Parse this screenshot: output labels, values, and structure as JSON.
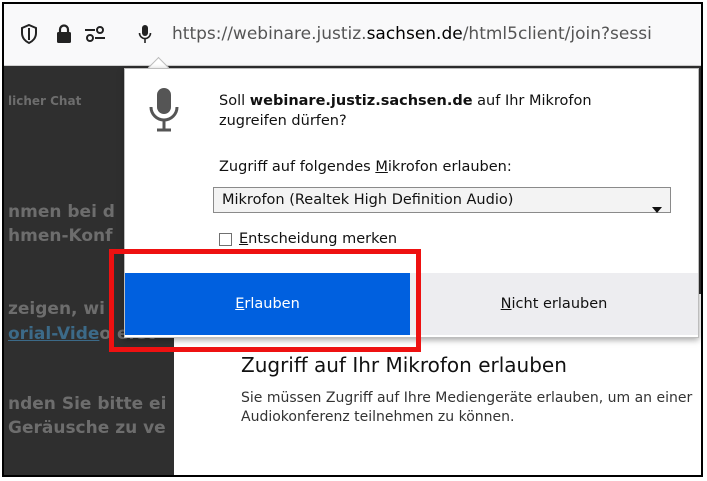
{
  "urlbar": {
    "url_prefix": "https://webinare.justiz.",
    "url_host": "sachsen.de",
    "url_suffix": "/html5client/join?sessi",
    "icons": [
      "shield-icon",
      "lock-icon",
      "permissions-icon",
      "microphone-icon"
    ]
  },
  "page": {
    "line1": "licher Chat",
    "line2": "nmen bei d",
    "line3": "hmen-Konf",
    "line4": "zeigen, wi",
    "line5_link": "orial-Vide",
    "line5_rest": "o erst",
    "line6": "nden Sie bitte ei",
    "line7": "Geräusche zu ve"
  },
  "dialog_bg": {
    "title": "Zugriff auf Ihr Mikrofon erlauben",
    "body": "Sie müssen Zugriff auf Ihre Mediengeräte erlauben, um an einer Audiokonferenz teilnehmen zu können."
  },
  "popup": {
    "question_prefix": "Soll ",
    "question_host": "webinare.justiz.sachsen.de",
    "question_suffix": " auf Ihr Mikrofon zugreifen dürfen?",
    "select_label_pre": "Zugriff auf folgendes ",
    "select_label_u": "M",
    "select_label_post": "ikrofon erlauben:",
    "select_value": "Mikrofon (Realtek High Definition Audio)",
    "remember_u": "E",
    "remember_rest": "ntscheidung merken",
    "allow_u": "E",
    "allow_rest": "rlauben",
    "deny_u": "N",
    "deny_rest": "icht erlauben"
  },
  "colors": {
    "allow_button": "#0060df",
    "highlight": "#ee1111"
  }
}
